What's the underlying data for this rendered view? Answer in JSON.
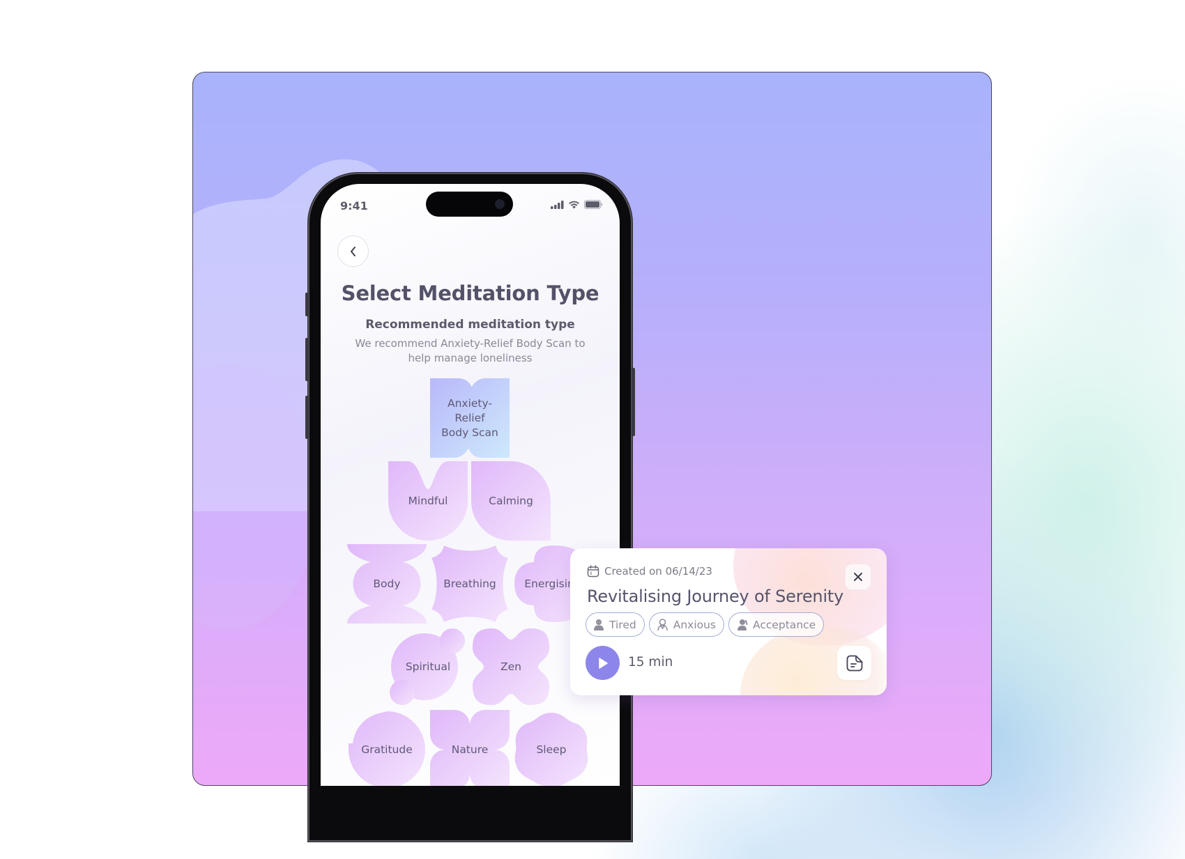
{
  "colors": {
    "accent": "#8d86ea",
    "text_primary": "#545269",
    "text_secondary": "#8a8896",
    "tag_border": "#a3abd6",
    "shape_purple": "#e4c2f9",
    "shape_blue": "#c3d6fa"
  },
  "phone": {
    "status_bar": {
      "time": "9:41",
      "icons": [
        "signal-icon",
        "wifi-icon",
        "battery-icon"
      ]
    },
    "back_icon": "chevron-left-icon",
    "title": "Select Meditation Type",
    "subtitle": "Recommended meditation type",
    "description": "We recommend Anxiety-Relief Body Scan to help manage loneliness",
    "meditation_types": [
      {
        "label": "Anxiety-\nRelief\nBody Scan",
        "recommended": true
      },
      {
        "label": "Mindful"
      },
      {
        "label": "Calming"
      },
      {
        "label": "Body"
      },
      {
        "label": "Breathing"
      },
      {
        "label": "Energising"
      },
      {
        "label": "Spiritual"
      },
      {
        "label": "Zen"
      },
      {
        "label": "Gratitude"
      },
      {
        "label": "Nature"
      },
      {
        "label": "Sleep"
      }
    ]
  },
  "card": {
    "created_icon": "calendar-icon",
    "created_label": "Created on 06/14/23",
    "title": "Revitalising Journey of Serenity",
    "tags": [
      {
        "icon": "tired-person-icon",
        "label": "Tired"
      },
      {
        "icon": "anxious-person-icon",
        "label": "Anxious"
      },
      {
        "icon": "acceptance-person-icon",
        "label": "Acceptance"
      }
    ],
    "duration": "15 min",
    "close_icon": "close-icon",
    "play_icon": "play-icon",
    "notes_icon": "note-icon"
  }
}
